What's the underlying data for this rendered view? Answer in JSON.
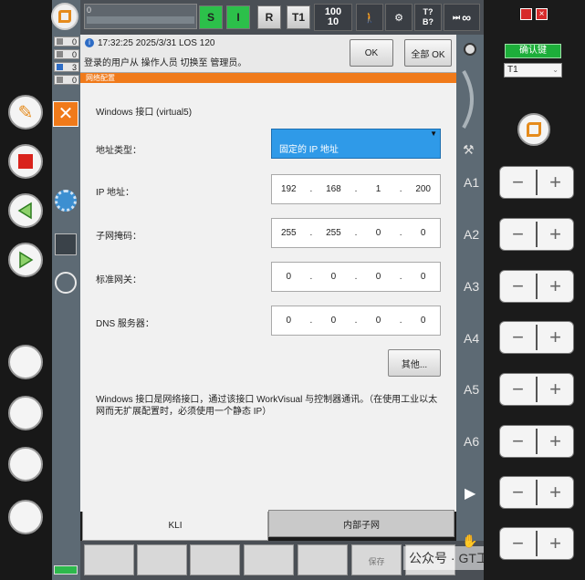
{
  "top_bar": {
    "progress_value": "0",
    "mode_s": "S",
    "mode_i": "I",
    "mode_r": "R",
    "op_mode": "T1",
    "override_prog": "100",
    "override_jog": "10",
    "tool_label": "T?",
    "base_label": "B?",
    "infinity": "∞"
  },
  "counters": [
    "0",
    "0",
    "3",
    "0"
  ],
  "message": {
    "time_line": "17:32:25 2025/3/31 LOS 120",
    "text": "登录的用户从 操作人员 切换至 管理员。",
    "ok_label": "OK",
    "all_ok_label": "全部 OK"
  },
  "window": {
    "title": "网络配置"
  },
  "network": {
    "interface_label": "Windows 接口 (virtual5)",
    "address_type_label": "地址类型：",
    "address_type_value": "固定的 IP 地址",
    "ip_label": "IP 地址：",
    "ip": [
      "192",
      "168",
      "1",
      "200"
    ],
    "subnet_label": "子网掩码：",
    "subnet": [
      "255",
      "255",
      "0",
      "0"
    ],
    "gateway_label": "标准网关：",
    "gateway": [
      "0",
      "0",
      "0",
      "0"
    ],
    "dns_label": "DNS 服务器：",
    "dns": [
      "0",
      "0",
      "0",
      "0"
    ],
    "other_button": "其他...",
    "note": "Windows 接口是网络接口，通过该接口 WorkVisual 与控制器通讯。（在使用工业以太网而无扩展配置时，必须使用一个静态 IP）"
  },
  "tabs": {
    "kli": "KLI",
    "internal_subnet": "内部子网"
  },
  "bottom": {
    "save_label": "保存"
  },
  "watermark": "公众号 · GT工业设计",
  "right": {
    "confirm_label": "确认键",
    "tool_select": "T1",
    "axes": [
      "A1",
      "A2",
      "A3",
      "A4",
      "A5",
      "A6"
    ],
    "minus": "−",
    "plus": "+"
  },
  "colors": {
    "accent_orange": "#f07a1a",
    "green_button": "#1dae3a",
    "dropdown_blue": "#2f9ae8"
  }
}
